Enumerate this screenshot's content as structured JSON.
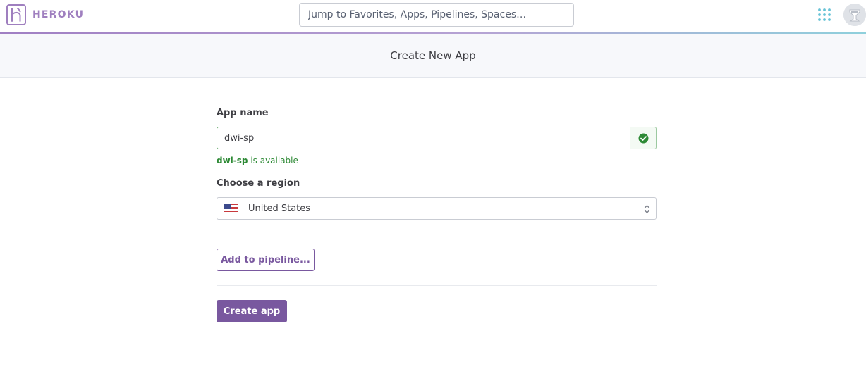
{
  "header": {
    "brand": "HEROKU",
    "search_placeholder": "Jump to Favorites, Apps, Pipelines, Spaces…"
  },
  "page": {
    "title": "Create New App"
  },
  "form": {
    "app_name_label": "App name",
    "app_name_value": "dwi-sp",
    "availability_name": "dwi-sp",
    "availability_suffix": " is available",
    "region_label": "Choose a region",
    "region_value": "United States",
    "pipeline_button": "Add to pipeline...",
    "create_button": "Create app"
  },
  "icons": {
    "logo": "heroku-logo-icon",
    "apps": "apps-grid-icon",
    "avatar": "avatar-icon",
    "valid": "check-circle-icon",
    "flag": "us-flag-icon",
    "caret": "select-caret-icon"
  },
  "colors": {
    "brand_purple": "#79589f",
    "logo_purple": "#9f7fbf",
    "success_green": "#2e8a36",
    "apps_icon_teal": "#67c3d6"
  }
}
